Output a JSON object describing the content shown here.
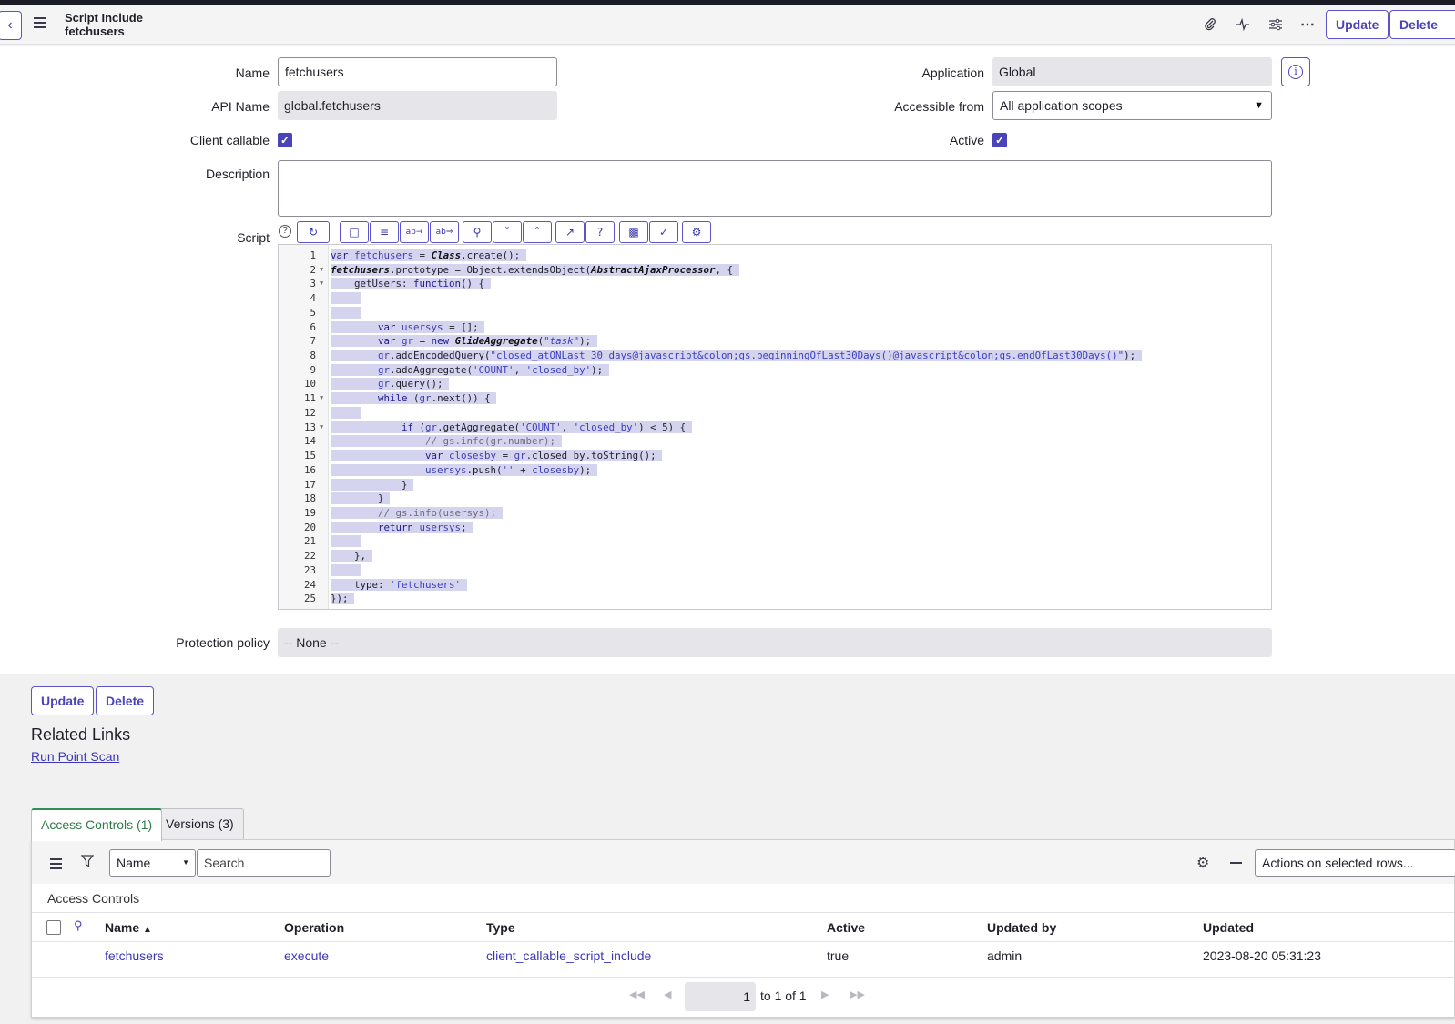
{
  "header": {
    "title_line1": "Script Include",
    "title_line2": "fetchusers",
    "update_label": "Update",
    "delete_label": "Delete"
  },
  "form": {
    "name_label": "Name",
    "name_value": "fetchusers",
    "api_name_label": "API Name",
    "api_name_value": "global.fetchusers",
    "client_callable_label": "Client callable",
    "client_callable_checked": true,
    "description_label": "Description",
    "description_value": "",
    "application_label": "Application",
    "application_value": "Global",
    "accessible_label": "Accessible from",
    "accessible_value": "All application scopes",
    "active_label": "Active",
    "active_checked": true,
    "script_label": "Script",
    "protection_label": "Protection policy",
    "protection_value": "-- None --"
  },
  "script": {
    "line_numbers": [
      "1",
      "2",
      "3",
      "4",
      "5",
      "6",
      "7",
      "8",
      "9",
      "10",
      "11",
      "12",
      "13",
      "14",
      "15",
      "16",
      "17",
      "18",
      "19",
      "20",
      "21",
      "22",
      "23",
      "24",
      "25"
    ],
    "foldable_lines": [
      2,
      3,
      11,
      13
    ]
  },
  "bottom": {
    "update_label": "Update",
    "delete_label": "Delete",
    "related_links_title": "Related Links",
    "run_point_scan": "Run Point Scan",
    "tabs": [
      {
        "label": "Access Controls (1)",
        "active": true
      },
      {
        "label": "Versions (3)",
        "active": false
      }
    ],
    "search_field_select": "Name",
    "search_placeholder": "Search",
    "actions_select": "Actions on selected rows...",
    "list_title": "Access Controls",
    "columns": [
      "Name",
      "Operation",
      "Type",
      "Active",
      "Updated by",
      "Updated"
    ],
    "rows": [
      {
        "name": "fetchusers",
        "operation": "execute",
        "type": "client_callable_script_include",
        "active": "true",
        "updated_by": "admin",
        "updated": "2023-08-20 05:31:23"
      }
    ],
    "pagination": {
      "page": "1",
      "of_text": "to 1 of 1"
    }
  },
  "colors": {
    "accent": "#4b44b8",
    "selection": "#d5d4ef"
  }
}
